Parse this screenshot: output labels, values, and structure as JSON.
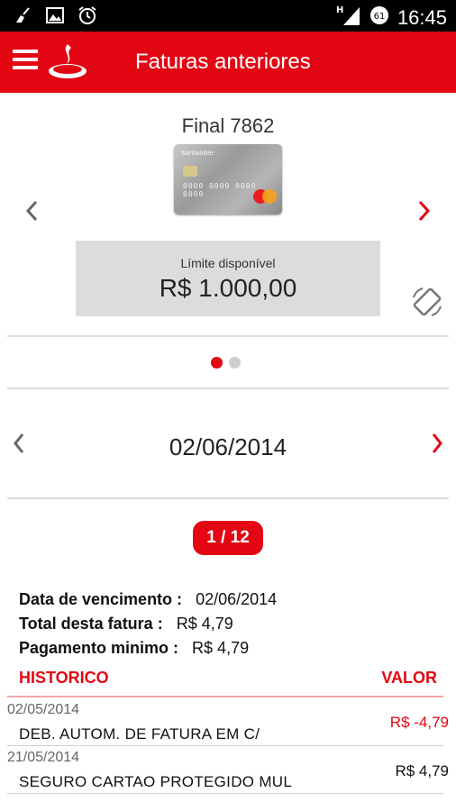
{
  "status_bar": {
    "time": "16:45",
    "network": "H",
    "battery": "61"
  },
  "app_bar": {
    "title": "Faturas anteriores"
  },
  "card": {
    "title": "Final 7862",
    "brand": "Santander",
    "number_mask": "0000 0000 0000 0000",
    "limit_label": "Límite disponível",
    "limit_value": "R$ 1.000,00"
  },
  "pager": {
    "total": 2,
    "active": 1
  },
  "invoice": {
    "date": "02/06/2014",
    "page": "1 / 12",
    "due_label": "Data de vencimento :",
    "due_value": "02/06/2014",
    "total_label": "Total desta fatura :",
    "total_value": "R$ 4,79",
    "min_label": "Pagamento minimo :",
    "min_value": "R$ 4,79"
  },
  "history": {
    "col_history": "HISTORICO",
    "col_value": "VALOR",
    "rows": [
      {
        "date": "02/05/2014",
        "desc": "DEB. AUTOM. DE FATURA EM C/",
        "value": "R$  -4,79"
      },
      {
        "date": "21/05/2014",
        "desc": "SEGURO CARTAO PROTEGIDO MUL",
        "value": "R$ 4,79"
      }
    ]
  },
  "colors": {
    "brand_red": "#e30613",
    "negative_value": "#e30613"
  },
  "icons": [
    "clean-icon",
    "image-icon",
    "alarm-icon",
    "signal-icon",
    "battery-icon",
    "menu-icon",
    "santander-logo",
    "chevron-left-icon",
    "chevron-right-icon",
    "rotate-screen-icon"
  ]
}
